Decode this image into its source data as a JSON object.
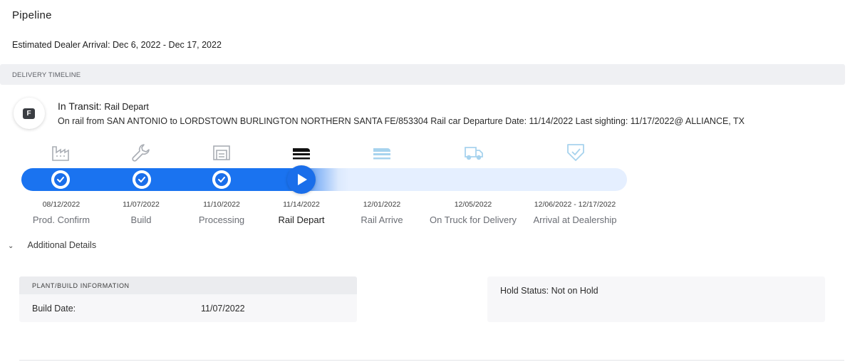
{
  "page": {
    "title": "Pipeline",
    "estimated_arrival": "Estimated Dealer Arrival: Dec 6, 2022 - Dec 17, 2022"
  },
  "timeline": {
    "section_title": "DELIVERY TIMELINE",
    "status_letter": "F",
    "status_main": "In Transit:",
    "status_sub": "Rail Depart",
    "transit_detail": "On rail from SAN ANTONIO to LORDSTOWN BURLINGTON NORTHERN SANTA FE/853304 Rail car Departure Date: 11/14/2022 Last sighting: 11/17/2022@ ALLIANCE, TX",
    "progress_percent": 47,
    "colors": {
      "accent": "#1a73f0",
      "track_pending": "#e5efff",
      "icon_done": "#a9adb4",
      "icon_current": "#111111",
      "icon_pending": "#a7d3ee"
    },
    "stages": [
      {
        "date": "08/12/2022",
        "label": "Prod. Confirm",
        "icon": "factory-icon",
        "state": "done"
      },
      {
        "date": "11/07/2022",
        "label": "Build",
        "icon": "wrench-icon",
        "state": "done"
      },
      {
        "date": "11/10/2022",
        "label": "Processing",
        "icon": "processing-icon",
        "state": "done"
      },
      {
        "date": "11/14/2022",
        "label": "Rail Depart",
        "icon": "rail-icon",
        "state": "current"
      },
      {
        "date": "12/01/2022",
        "label": "Rail Arrive",
        "icon": "rail-arrive-icon",
        "state": "pending"
      },
      {
        "date": "12/05/2022",
        "label": "On Truck for Delivery",
        "icon": "truck-icon",
        "state": "pending"
      },
      {
        "date": "12/06/2022 - 12/17/2022",
        "label": "Arrival at Dealership",
        "icon": "shield-check-icon",
        "state": "pending"
      }
    ]
  },
  "details": {
    "toggle_label": "Additional Details",
    "plant": {
      "header": "PLANT/BUILD INFORMATION",
      "build_date_label": "Build Date:",
      "build_date_value": "11/07/2022"
    },
    "hold_status": "Hold Status: Not on Hold"
  }
}
